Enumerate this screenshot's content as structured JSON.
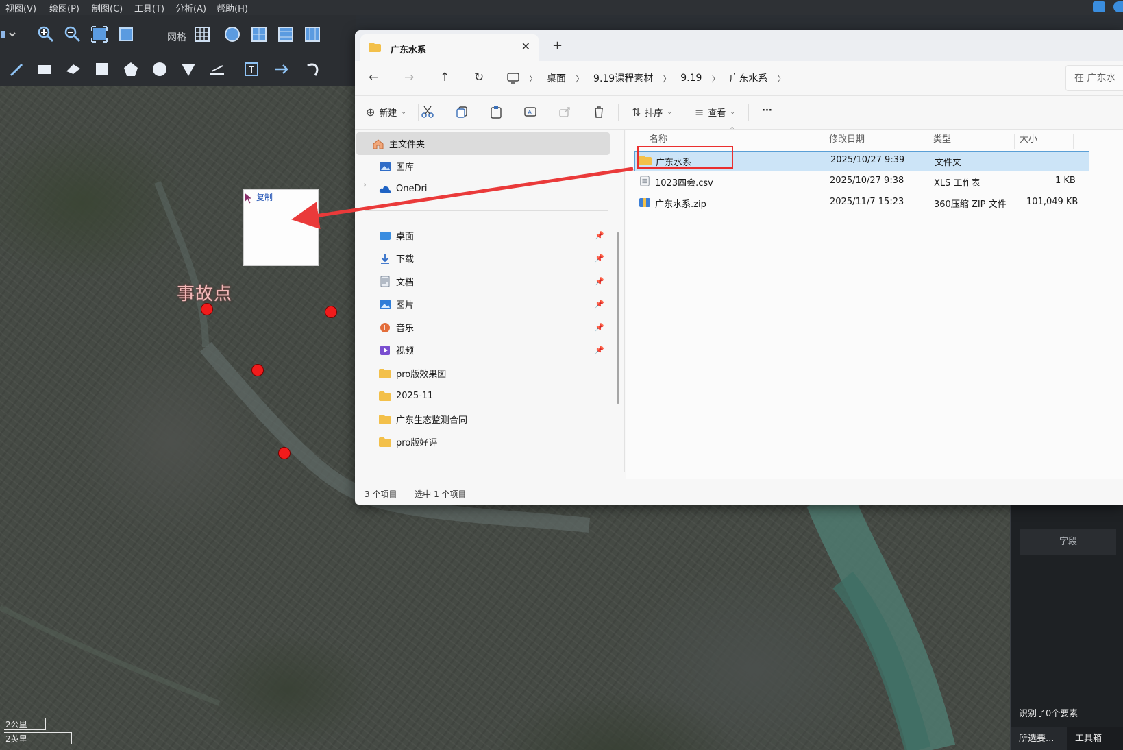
{
  "gis": {
    "menu": [
      "视图(V)",
      "绘图(P)",
      "制图(C)",
      "工具(T)",
      "分析(A)",
      "帮助(H)"
    ],
    "grid_label": "网格",
    "map": {
      "accident_label": "事故点",
      "point_color": "#f11b1b",
      "drag_tooltip": "复制",
      "scale_km": "2公里",
      "scale_mi": "2英里"
    },
    "side_panel": {
      "field_header": "字段",
      "status_msg": "识别了0个要素",
      "tab_selection": "所选要...",
      "tab_toolbox": "工具箱"
    }
  },
  "explorer": {
    "tab_title": "广东水系",
    "new_tab": "+",
    "breadcrumbs": [
      "桌面",
      "9.19课程素材",
      "9.19",
      "广东水系"
    ],
    "search_placeholder": "在 广东水",
    "commands": {
      "new": "新建",
      "sort": "排序",
      "view": "查看",
      "more": "···"
    },
    "nav": {
      "home": "主文件夹",
      "gallery": "图库",
      "onedrive": "OneDri",
      "desktop": "桌面",
      "downloads": "下载",
      "documents": "文档",
      "pictures": "图片",
      "music": "音乐",
      "videos": "视频",
      "folders": [
        "pro版效果图",
        "2025-11",
        "广东生态监测合同",
        "pro版好评"
      ]
    },
    "columns": {
      "name": "名称",
      "modified": "修改日期",
      "type": "类型",
      "size": "大小"
    },
    "files": [
      {
        "name": "广东水系",
        "modified": "2025/10/27 9:39",
        "type": "文件夹",
        "size": "",
        "icon": "folder-icon"
      },
      {
        "name": "1023四会.csv",
        "modified": "2025/10/27 9:38",
        "type": "XLS 工作表",
        "size": "1 KB",
        "icon": "csv-file-icon"
      },
      {
        "name": "广东水系.zip",
        "modified": "2025/11/7 15:23",
        "type": "360压缩 ZIP 文件",
        "size": "101,049 KB",
        "icon": "zip-file-icon"
      }
    ],
    "status": {
      "count": "3 个项目",
      "selected": "选中 1 个项目"
    }
  },
  "colors": {
    "accent": "#5a9fd6",
    "selection": "#cce4f7",
    "annotation_red": "#ea2f2f"
  }
}
